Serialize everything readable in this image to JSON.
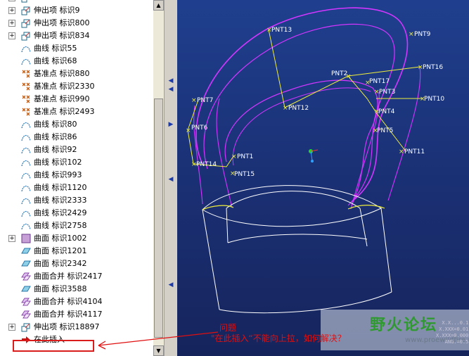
{
  "model_tree": {
    "items": [
      {
        "label": "...",
        "type": "protrusion",
        "expandable": true,
        "partial": true
      },
      {
        "label": "伸出项 标识9",
        "type": "protrusion",
        "expandable": true
      },
      {
        "label": "伸出项 标识800",
        "type": "protrusion",
        "expandable": true
      },
      {
        "label": "伸出项 标识834",
        "type": "protrusion",
        "expandable": true
      },
      {
        "label": "曲线 标识55",
        "type": "curve",
        "expandable": false
      },
      {
        "label": "曲线 标识68",
        "type": "curve",
        "expandable": false
      },
      {
        "label": "基准点 标识880",
        "type": "datum-point",
        "expandable": false
      },
      {
        "label": "基准点 标识2330",
        "type": "datum-point",
        "expandable": false
      },
      {
        "label": "基准点 标识990",
        "type": "datum-point",
        "expandable": false
      },
      {
        "label": "基准点 标识2493",
        "type": "datum-point",
        "expandable": false
      },
      {
        "label": "曲线 标识80",
        "type": "curve",
        "expandable": false
      },
      {
        "label": "曲线 标识86",
        "type": "curve",
        "expandable": false
      },
      {
        "label": "曲线 标识92",
        "type": "curve",
        "expandable": false
      },
      {
        "label": "曲线 标识102",
        "type": "curve",
        "expandable": false
      },
      {
        "label": "曲线 标识993",
        "type": "curve",
        "expandable": false
      },
      {
        "label": "曲线 标识1120",
        "type": "curve",
        "expandable": false
      },
      {
        "label": "曲线 标识2333",
        "type": "curve",
        "expandable": false
      },
      {
        "label": "曲线 标识2429",
        "type": "curve",
        "expandable": false
      },
      {
        "label": "曲线 标识2758",
        "type": "curve",
        "expandable": false
      },
      {
        "label": "曲面 标识1002",
        "type": "surface-box",
        "expandable": true
      },
      {
        "label": "曲面 标识1201",
        "type": "surface",
        "expandable": false
      },
      {
        "label": "曲面 标识2342",
        "type": "surface",
        "expandable": false
      },
      {
        "label": "曲面合并 标识2417",
        "type": "merge",
        "expandable": false
      },
      {
        "label": "曲面 标识3588",
        "type": "surface",
        "expandable": false
      },
      {
        "label": "曲面合并 标识4104",
        "type": "merge",
        "expandable": false
      },
      {
        "label": "曲面合并 标识4117",
        "type": "merge",
        "expandable": false
      },
      {
        "label": "伸出项 标识18897",
        "type": "protrusion",
        "expandable": true
      },
      {
        "label": "在此插入",
        "type": "insert-here",
        "expandable": false
      }
    ]
  },
  "datum_points": [
    "PNT13",
    "PNT9",
    "PNT16",
    "PNT2",
    "PNT17",
    "PNT3",
    "PNT10",
    "PNT7",
    "PNT12",
    "PNT4",
    "PNT6",
    "PNT5",
    "PNT1",
    "PNT11",
    "PNT14",
    "PNT15"
  ],
  "annotation": {
    "title": "问题",
    "text": "\"在此插入“不能向上拉，如何解决？"
  },
  "watermark": {
    "text": "野火论坛",
    "subtext": "www.proewildfire.cn"
  },
  "coord_readout": [
    "X.X...0.1",
    "X.XXX=0.01",
    "X.XXX=0.000",
    "ANG.=0.5"
  ],
  "colors": {
    "viewport_bg": "#1d3a86",
    "curve_magenta": "#d236ff",
    "curve_yellow": "#f0ee3a",
    "annotation_red": "#e01010"
  }
}
